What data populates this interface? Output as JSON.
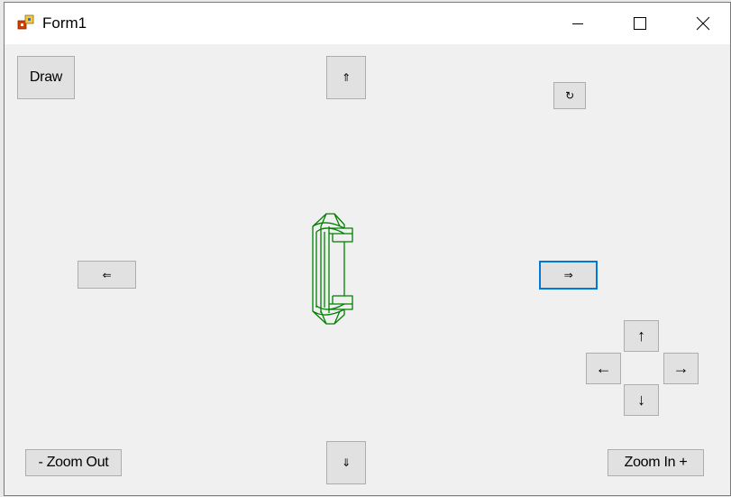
{
  "window": {
    "title": "Form1",
    "icon": "form-app-icon",
    "controls": [
      "minimize-icon",
      "maximize-icon",
      "close-icon"
    ]
  },
  "buttons": {
    "draw": "Draw",
    "move_up": "⇑",
    "rotate": "↻",
    "move_left": "⇐",
    "move_right": "⇒",
    "move_down": "⇓",
    "arrow_up": "↑",
    "arrow_left": "←",
    "arrow_right": "→",
    "arrow_down": "↓",
    "zoom_out": "- Zoom Out",
    "zoom_in": "Zoom In +"
  },
  "drawing": {
    "shape": "3D wireframe letter C",
    "stroke_color": "#008000"
  },
  "colors": {
    "focus_border": "#0078d7",
    "button_face": "#e1e1e1",
    "form_background": "#f0f0f0"
  }
}
